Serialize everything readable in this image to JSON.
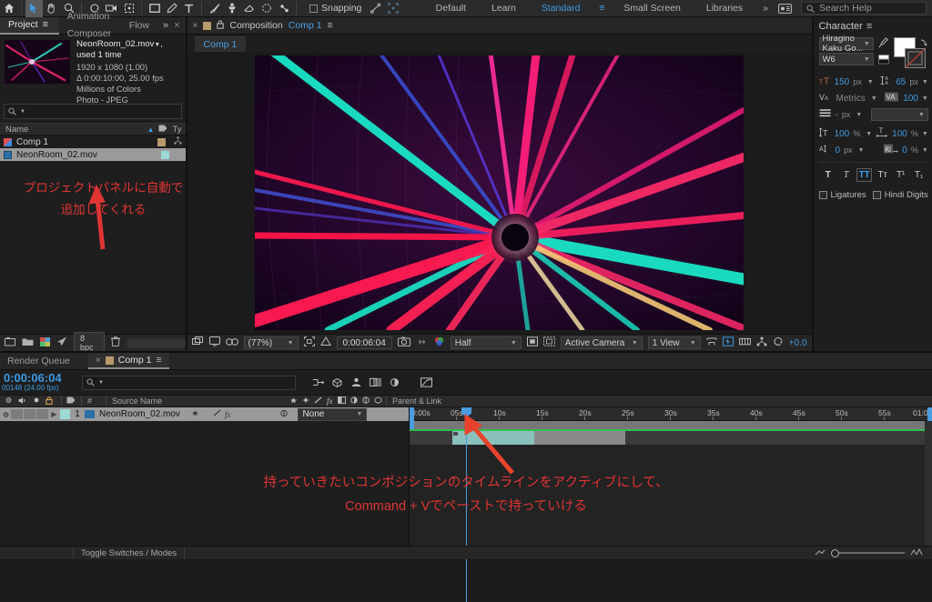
{
  "app": {
    "name": "Adobe After Effects"
  },
  "toolbar": {
    "tools": [
      {
        "name": "home-icon",
        "label": "Home"
      },
      {
        "name": "selection-tool",
        "label": "Selection",
        "selected": true
      },
      {
        "name": "hand-tool",
        "label": "Hand"
      },
      {
        "name": "zoom-tool",
        "label": "Zoom"
      },
      {
        "name": "rotation-tool",
        "label": "Rotation"
      },
      {
        "name": "camera-tool",
        "label": "Unified Camera"
      },
      {
        "name": "anchor-point-tool",
        "label": "Pan Behind"
      },
      {
        "name": "shape-tool",
        "label": "Rectangle"
      },
      {
        "name": "pen-tool",
        "label": "Pen"
      },
      {
        "name": "type-tool",
        "label": "Type"
      },
      {
        "name": "brush-tool",
        "label": "Brush"
      },
      {
        "name": "clone-stamp-tool",
        "label": "Clone Stamp"
      },
      {
        "name": "eraser-tool",
        "label": "Eraser"
      },
      {
        "name": "roto-brush-tool",
        "label": "Roto Brush"
      },
      {
        "name": "puppet-tool",
        "label": "Puppet"
      }
    ],
    "snapping_label": "Snapping",
    "snapping_checked": false,
    "workspaces": [
      "Default",
      "Learn",
      "Standard",
      "Small Screen",
      "Libraries"
    ],
    "active_workspace": "Standard",
    "overflow_label": "»",
    "search_placeholder": "Search Help"
  },
  "project": {
    "tabs": [
      {
        "label": "Project",
        "active": true
      },
      {
        "label": "Animation Composer",
        "active": false
      },
      {
        "label": "Flow",
        "active": false
      }
    ],
    "overflow": "»",
    "close": "×",
    "preview": {
      "title": "NeonRoom_02.mov",
      "used": ", used 1 time",
      "lines": [
        "1920 x 1080 (1.00)",
        "Δ 0:00:10:00, 25.00 fps",
        "Millions of Colors",
        "Photo - JPEG"
      ]
    },
    "search_placeholder": "",
    "columns": [
      "Name",
      "Ty"
    ],
    "items": [
      {
        "name": "Comp 1",
        "kind": "composition",
        "selected": false,
        "swatch": "#b79b6a"
      },
      {
        "name": "NeonRoom_02.mov",
        "kind": "footage",
        "selected": true,
        "swatch": "#9ad9d4"
      }
    ],
    "footer": {
      "bpc": "8 bpc"
    },
    "annotation": [
      "プロジェクトパネルに自動で",
      "追加してくれる"
    ]
  },
  "composition": {
    "tab_close": "×",
    "label": "Composition",
    "name": "Comp 1",
    "menu": "≡",
    "subtab": "Comp 1",
    "footer": {
      "zoom": "(77%)",
      "timecode": "0:00:06:04",
      "resolution": "Half",
      "view": "Active Camera",
      "views": "1 View",
      "exposure": "+0.0"
    }
  },
  "character": {
    "title": "Character",
    "menu": "≡",
    "font_family": "Hiragino Kaku Go...",
    "font_style": "W6",
    "font_size": {
      "value": "150",
      "unit": "px"
    },
    "leading": {
      "value": "65",
      "unit": "px"
    },
    "kerning": {
      "value": "Metrics",
      "unit": ""
    },
    "tracking": {
      "value": "100",
      "unit": ""
    },
    "stroke_width": {
      "value": "-",
      "unit": "px"
    },
    "stroke_type": "",
    "vertical_scale": {
      "value": "100",
      "unit": "%"
    },
    "horizontal_scale": {
      "value": "100",
      "unit": "%"
    },
    "baseline_shift": {
      "value": "0",
      "unit": "px"
    },
    "tsume": {
      "value": "0",
      "unit": "%"
    },
    "style_buttons": [
      {
        "name": "faux-bold",
        "glyph": "T",
        "active": false
      },
      {
        "name": "faux-italic",
        "glyph": "T",
        "active": false
      },
      {
        "name": "all-caps",
        "glyph": "TT",
        "active": true
      },
      {
        "name": "small-caps",
        "glyph": "Tᴛ",
        "active": false
      },
      {
        "name": "superscript",
        "glyph": "T¹",
        "active": false
      },
      {
        "name": "subscript",
        "glyph": "T₁",
        "active": false
      }
    ],
    "ligatures_label": "Ligatures",
    "ligatures_checked": false,
    "hindi_label": "Hindi Digits",
    "hindi_checked": false
  },
  "timeline": {
    "tabs": [
      {
        "label": "Render Queue",
        "active": false
      },
      {
        "label": "Comp 1",
        "active": true
      }
    ],
    "current_time": "0:00:06:04",
    "frame_info": "00148 (24.00 fps)",
    "search_placeholder": "",
    "columns": [
      "#",
      "Source Name",
      "Parent & Link"
    ],
    "layers": [
      {
        "index": "1",
        "name": "NeonRoom_02.mov",
        "parent": "None",
        "selected": true,
        "color": "#9ad9d4"
      }
    ],
    "ruler_ticks": [
      "0:00s",
      "05s",
      "10s",
      "15s",
      "20s",
      "25s",
      "30s",
      "35s",
      "40s",
      "45s",
      "50s",
      "55s",
      "01:0"
    ],
    "footer_label": "Toggle Switches / Modes",
    "annotation": [
      "持っていきたいコンポジションのタイムラインをアクティブにして、",
      "Command + Vでペーストで持っていける"
    ]
  },
  "colors": {
    "accent_blue": "#3d9ae2",
    "annotation_red": "#e03434",
    "panel_bg": "#1e1e1e",
    "green_bar": "#2fbf4c"
  }
}
